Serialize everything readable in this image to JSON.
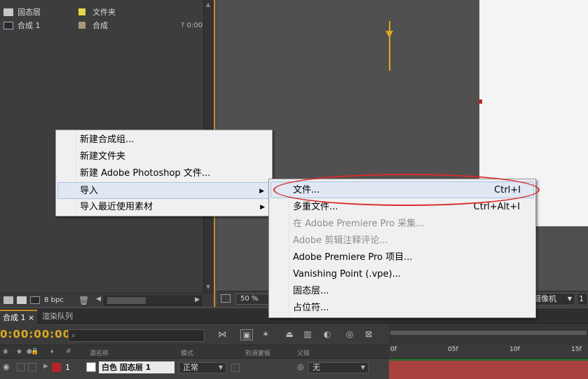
{
  "project": {
    "items": [
      {
        "name": "固态层",
        "type": "文件夹",
        "label_color": "#e3d84a",
        "duration": ""
      },
      {
        "name": "合成 1",
        "type": "合成",
        "label_color": "#a89878",
        "duration": "? 0:00"
      }
    ],
    "footer": {
      "bpc": "8 bpc"
    }
  },
  "viewer": {
    "zoom": "50 %",
    "camera": "摄像机",
    "view_num": "1"
  },
  "timeline": {
    "tabs": [
      {
        "label": "合成 1 ×"
      },
      {
        "label": "渲染队列"
      }
    ],
    "timecode": "0:00:00:00",
    "headers": {
      "source_name": "源名称",
      "mode": "模式",
      "track_matte": "轨道蒙板",
      "parent": "父级",
      "hash": "#"
    },
    "ruler_ticks": [
      "0f",
      "05f",
      "10f",
      "15f"
    ],
    "layer": {
      "number": "1",
      "name": "白色 固态层 1",
      "mode": "正常",
      "parent": "无",
      "label_color": "#b4252a"
    }
  },
  "context_menu": {
    "items": [
      {
        "label": "新建合成组..."
      },
      {
        "label": "新建文件夹"
      },
      {
        "label": "新建 Adobe Photoshop 文件..."
      },
      {
        "label": "导入",
        "arrow": "▶"
      },
      {
        "label": "导入最近使用素材",
        "arrow": "▶"
      }
    ]
  },
  "import_submenu": {
    "items": [
      {
        "label": "文件...",
        "shortcut": "Ctrl+I"
      },
      {
        "label": "多重文件...",
        "shortcut": "Ctrl+Alt+I"
      },
      {
        "label": "在 Adobe Premiere Pro 采集..."
      },
      {
        "label": "Adobe 剪辑注释评论..."
      },
      {
        "label": "Adobe Premiere Pro 项目..."
      },
      {
        "label": "Vanishing Point (.vpe)..."
      },
      {
        "label": "固态层..."
      },
      {
        "label": "占位符..."
      }
    ]
  }
}
